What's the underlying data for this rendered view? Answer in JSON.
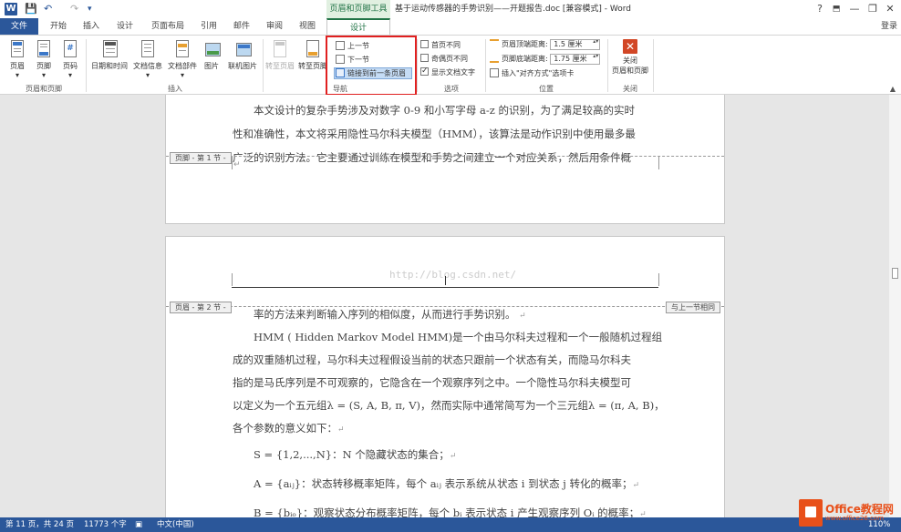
{
  "titlebar": {
    "app_icon": "W",
    "save_icon": "save-icon",
    "undo_icon": "undo-icon",
    "redo_icon": "redo-icon",
    "context_tools": "页眉和页脚工具",
    "title": "基于运动传感器的手势识别——开题报告.doc [兼容模式] - Word",
    "help": "?",
    "minimize": "—",
    "restore": "❐",
    "close": "✕"
  },
  "tabs": {
    "file": "文件",
    "home": "开始",
    "insert": "插入",
    "design": "设计",
    "layout": "页面布局",
    "references": "引用",
    "mailings": "邮件",
    "review": "审阅",
    "view": "视图",
    "hf_design": "设计",
    "login": "登录"
  },
  "ribbon": {
    "header": "页眉",
    "footer": "页脚",
    "page_number": "页码",
    "group_hf": "页眉和页脚",
    "datetime": "日期和时间",
    "docinfo": "文档信息",
    "docparts": "文档部件",
    "picture": "图片",
    "online_picture": "联机图片",
    "group_insert": "插入",
    "goto_header": "转至页眉",
    "goto_footer": "转至页脚",
    "prev_section": "上一节",
    "next_section": "下一节",
    "link_prev": "链接到前一条页眉",
    "group_nav": "导航",
    "first_page_diff": "首页不同",
    "odd_even_diff": "奇偶页不同",
    "show_doc_text": "显示文档文字",
    "group_options": "选项",
    "header_top_label": "页眉顶端距离:",
    "header_top_value": "1.5 厘米",
    "footer_bottom_label": "页脚底端距离:",
    "footer_bottom_value": "1.75 厘米",
    "insert_align_tab": "插入\"对齐方式\"选项卡",
    "group_position": "位置",
    "close_hf_line1": "关闭",
    "close_hf_line2": "页眉和页脚",
    "group_close": "关闭"
  },
  "document": {
    "page1_lines": [
      "本文设计的复杂手势涉及对数字 0-9 和小写字母 a-z 的识别，为了满足较高的实时",
      "性和准确性，本文将采用隐性马尔科夫模型（HMM），该算法是动作识别中使用最多最",
      "广泛的识别方法。它主要通过训练在模型和手势之间建立一个对应关系，然后用条件概"
    ],
    "footer_tag": "页脚 - 第 1 节 -",
    "header_tag": "页眉 - 第 2 节 -",
    "same_as_prev": "与上一节相同",
    "watermark": "http://blog.csdn.net/",
    "page2_lines": [
      "率的方法来判断输入序列的相似度，从而进行手势识别。",
      "HMM ( Hidden Markov Model HMM)是一个由马尔科夫过程和一个一般随机过程组",
      "成的双重随机过程，马尔科夫过程假设当前的状态只跟前一个状态有关，而隐马尔科夫",
      "指的是马氏序列是不可观察的，它隐含在一个观察序列之中。一个隐性马尔科夫模型可",
      "以定义为一个五元组λ = (S, A, B, π, V)，然而实际中通常简写为一个三元组λ = (π, A, B)，",
      "各个参数的意义如下：",
      "S = {1,2,...,N}：N 个隐藏状态的集合；",
      "A = {aᵢⱼ}：状态转移概率矩阵，每个 aᵢⱼ 表示系统从状态 i 到状态 j 转化的概率；",
      "B = {bᵢₒ}：观察状态分布概率矩阵，每个 bᵢ 表示状态 i 产生观察序列 Oᵢ 的概率；"
    ],
    "para_mark": "↵"
  },
  "statusbar": {
    "page": "第 11 页，共 24 页",
    "words": "11773 个字",
    "lang": "中文(中国)",
    "zoom": "110%"
  },
  "logo": {
    "text": "Office教程网",
    "sub": "www.office26.com"
  }
}
